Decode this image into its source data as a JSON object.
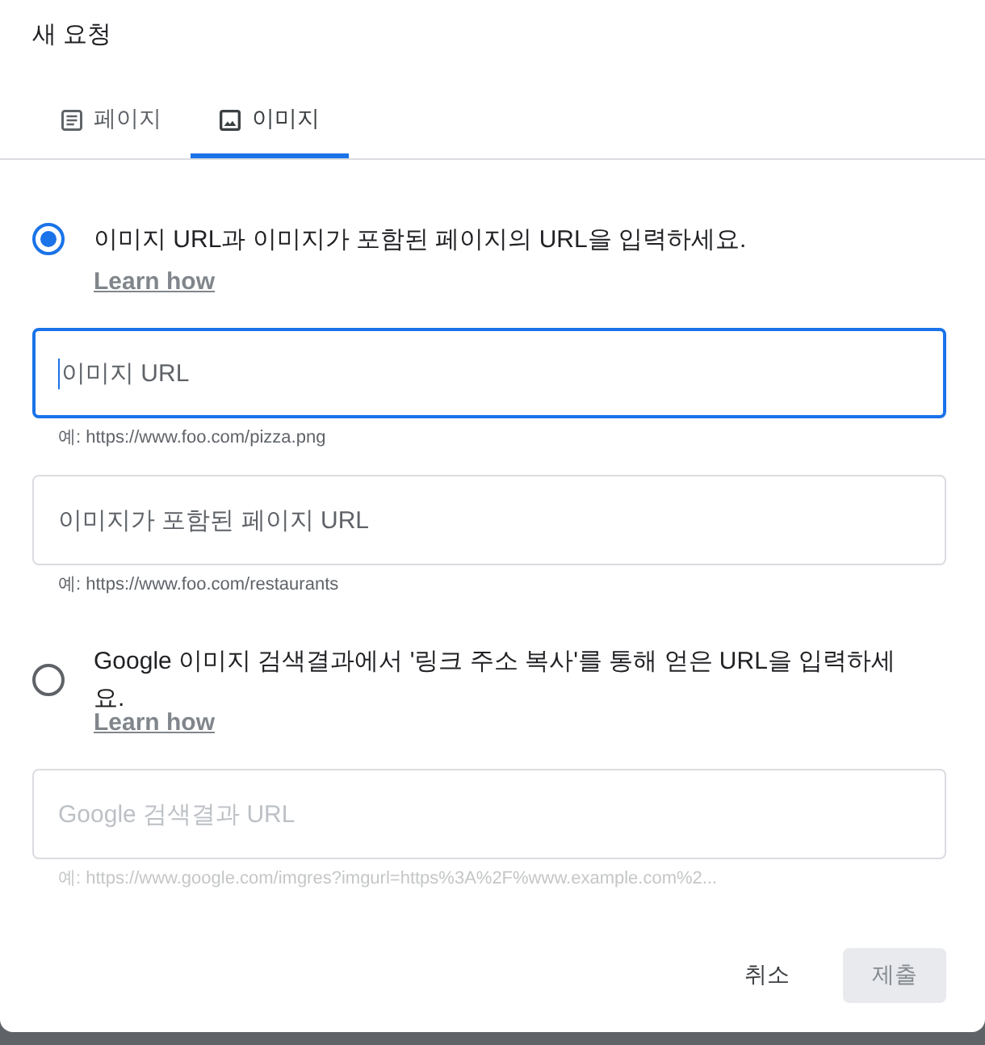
{
  "dialog": {
    "title": "새 요청"
  },
  "tabs": [
    {
      "label": "페이지",
      "kind": "document",
      "selected": false
    },
    {
      "label": "이미지",
      "kind": "image",
      "selected": true
    }
  ],
  "options": [
    {
      "text": "이미지 URL과 이미지가 포함된 페이지의 URL을 입력하세요.",
      "selected": true,
      "link": "Learn how",
      "fields": [
        {
          "placeholder": "이미지 URL",
          "focused": true,
          "disabled": false,
          "hint": "예: https://www.foo.com/pizza.png"
        },
        {
          "placeholder": "이미지가 포함된 페이지 URL",
          "focused": false,
          "disabled": false,
          "hint": "예: https://www.foo.com/restaurants"
        }
      ]
    },
    {
      "text": "Google 이미지 검색결과에서 '링크 주소 복사'를 통해 얻은 URL을 입력하세요.",
      "selected": false,
      "link": "Learn how",
      "fields": [
        {
          "placeholder": "Google 검색결과 URL",
          "focused": false,
          "disabled": true,
          "hint": "예: https://www.google.com/imgres?imgurl=https%3A%2F%www.example.com%2..."
        }
      ]
    }
  ],
  "buttons": [
    {
      "label": "취소",
      "kind": "text",
      "disabled": false
    },
    {
      "label": "제출",
      "kind": "filled",
      "disabled": true
    }
  ]
}
